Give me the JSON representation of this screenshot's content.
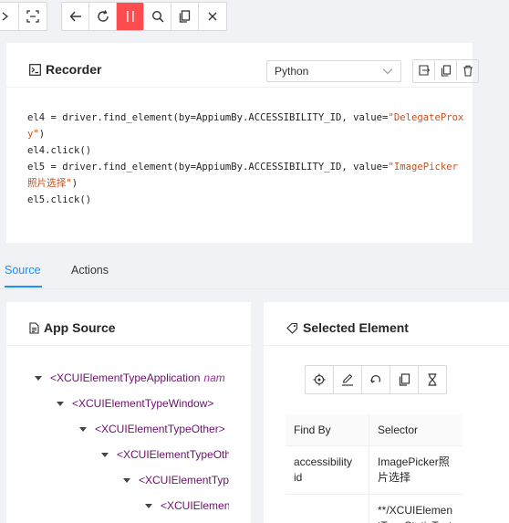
{
  "toolbar": {
    "left_group": [
      {
        "icon": "expand-icon"
      },
      {
        "icon": "select-area-icon"
      }
    ],
    "main_group": [
      {
        "icon": "back-arrow-icon"
      },
      {
        "icon": "refresh-icon"
      },
      {
        "icon": "pause-icon",
        "active": true
      },
      {
        "icon": "search-icon"
      },
      {
        "icon": "copy-icon"
      },
      {
        "icon": "close-icon"
      }
    ],
    "active_color": "#ff4d4f"
  },
  "recorder": {
    "title": "Recorder",
    "language": "Python",
    "code": [
      {
        "plain": "el4 = driver.find_element(by=AppiumBy.ACCESSIBILITY_ID, value=",
        "str": "\"DelegateProxy\"",
        "tail": ")"
      },
      {
        "plain": "el4.click()",
        "str": "",
        "tail": ""
      },
      {
        "plain": "el5 = driver.find_element(by=AppiumBy.ACCESSIBILITY_ID, value=",
        "str": "\"ImagePicker照片选择\"",
        "tail": ")"
      },
      {
        "plain": "el5.click()",
        "str": "",
        "tail": ""
      }
    ]
  },
  "tabs": {
    "source": "Source",
    "actions": "Actions",
    "active_color": "#1890ff"
  },
  "app_source": {
    "title": "App Source",
    "tree": [
      {
        "label": "<XCUIElementTypeApplication",
        "attr": "nam"
      },
      {
        "label": "<XCUIElementTypeWindow>",
        "attr": ""
      },
      {
        "label": "<XCUIElementTypeOther>",
        "attr": ""
      },
      {
        "label": "<XCUIElementTypeOther>",
        "attr": ""
      },
      {
        "label": "<XCUIElementTypeOther>",
        "attr": ""
      },
      {
        "label": "<XCUIElementTypeOther>",
        "attr": ""
      }
    ]
  },
  "selected_element": {
    "title": "Selected Element",
    "actions": [
      "tap-icon",
      "edit-icon",
      "undo-icon",
      "copy-icon",
      "hourglass-icon"
    ],
    "table_headers": [
      "Find By",
      "Selector"
    ],
    "rows": [
      {
        "find_by": "accessibility id",
        "selector": "ImagePicker照片选择"
      },
      {
        "find_by": "",
        "selector": "**/XCUIElementTypeStaticText"
      }
    ]
  }
}
